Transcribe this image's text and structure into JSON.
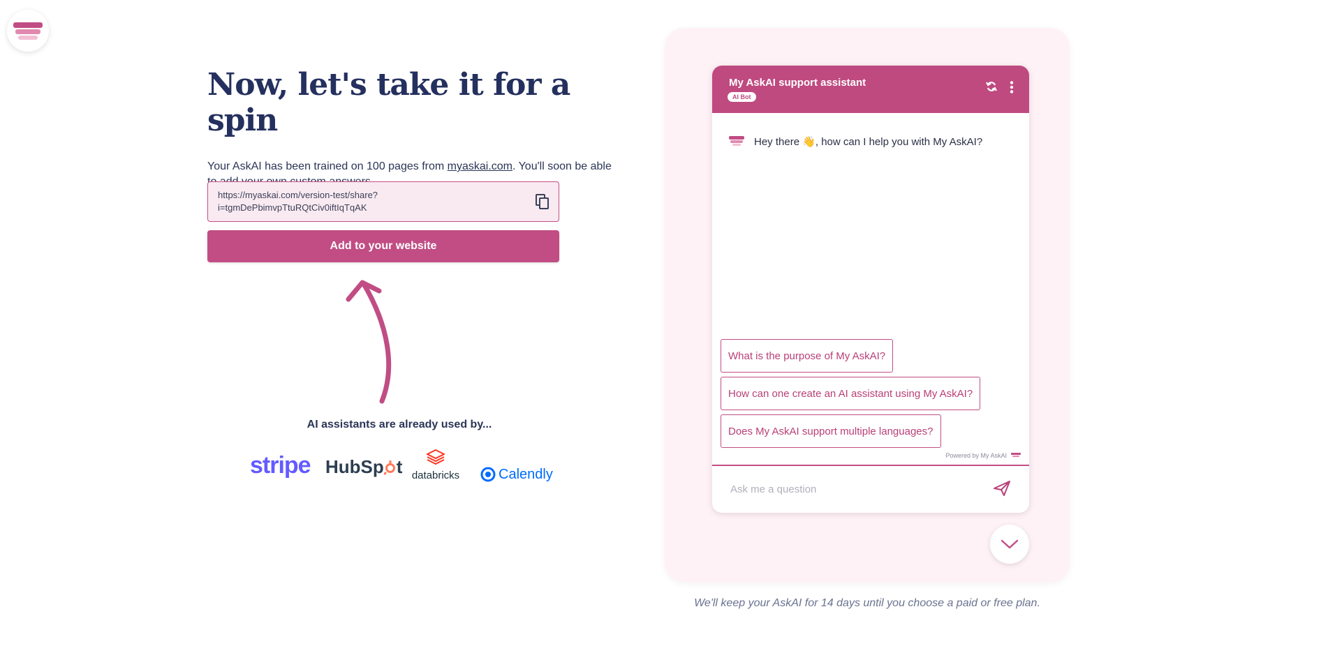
{
  "colors": {
    "accent": "#c14d84",
    "accent_light": "#f9eaf1",
    "panel_bg": "#fff2f6",
    "heading": "#24305e"
  },
  "headline": "Now, let's take it for a spin",
  "intro": {
    "prefix": "Your AskAI has been trained on 100 pages from ",
    "link": "myaskai.com",
    "suffix": ". You'll soon be able to add your own custom answers."
  },
  "share": {
    "line1": "https://myaskai.com/version-test/share?",
    "line2": "i=tgmDePbimvpTtuRQtCiv0iftIqTqAK",
    "copy_icon": "copy-icon"
  },
  "add_button_label": "Add to your website",
  "used_by": {
    "title": "AI assistants are already used by...",
    "logos": {
      "stripe": "stripe",
      "hubspot_pre": "HubSp",
      "hubspot_post": "t",
      "databricks": "databricks",
      "calendly": "Calendly"
    }
  },
  "widget": {
    "title": "My AskAI support assistant",
    "badge": "AI Bot",
    "greeting": "Hey there 👋, how can I help you with My AskAI?",
    "suggestions": [
      "What is the purpose of My AskAI?",
      "How can one create an AI assistant using My AskAI?",
      "Does My AskAI support multiple languages?"
    ],
    "powered_by": "Powered by My AskAI",
    "input_placeholder": "Ask me a question"
  },
  "footnote": "We'll keep your AskAI for 14 days until you choose a paid or free plan."
}
